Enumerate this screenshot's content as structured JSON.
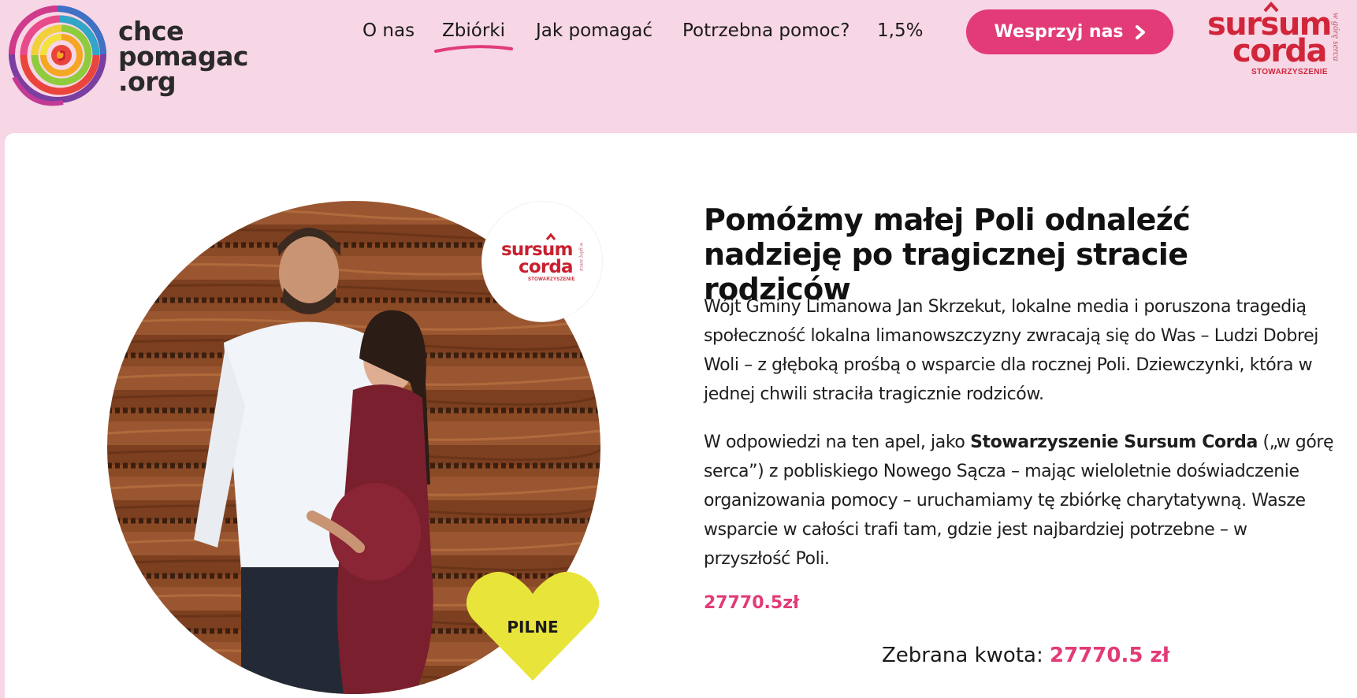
{
  "logo": {
    "line1": "chce",
    "line2": "pomagac",
    "line3": ".org"
  },
  "nav": {
    "items": [
      "O nas",
      "Zbiórki",
      "Jak pomagać",
      "Potrzebna pomoc?",
      "1,5%"
    ],
    "active": "Zbiórki"
  },
  "cta": {
    "label": "Wesprzyj nas"
  },
  "brand": {
    "word1": "sursum",
    "word2": "corda",
    "sub": "STOWARZYSZENIE",
    "side": "w górę serca"
  },
  "campaign": {
    "title": "Pomóżmy małej Poli odnaleźć nadzieję po tragicznej stracie rodziców",
    "paragraph1": "Wójt Gminy Limanowa Jan Skrzekut, lokalne media i poruszona tragedią społeczność lokalna limanowszczyzny zwracają się do Was – Ludzi Dobrej Woli – z głęboką prośbą o wsparcie dla rocznej Poli. Dziewczynki, która w jednej chwili straciła tragicznie rodziców.",
    "paragraph2_before": "W odpowiedzi na ten apel, jako ",
    "paragraph2_bold": "Stowarzyszenie Sursum Corda",
    "paragraph2_after": " („w górę serca”) z pobliskiego Nowego Sącza – mając wieloletnie doświadczenie organizowania pomocy – uruchamiamy tę zbiórkę charytatywną. Wasze wsparcie w całości trafi tam, gdzie jest najbardziej potrzebne – w przyszłość Poli.",
    "amount_short": "27770.5zł",
    "collected_label": "Zebrana kwota:",
    "collected_value": "27770.5 zł",
    "badge": "PILNE"
  },
  "colors": {
    "background": "#f7d6e5",
    "accent": "#e23b78",
    "brand_red": "#d1253a",
    "heart_yellow": "#e8e43a"
  }
}
